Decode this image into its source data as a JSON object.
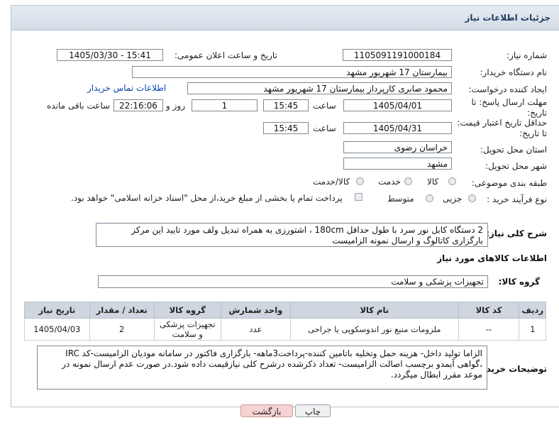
{
  "panel": {
    "title": "جزئیات اطلاعات نیاز"
  },
  "form": {
    "need_number": {
      "label": "شماره نیاز:",
      "value": "1105091191000184"
    },
    "announce": {
      "label": "تاریخ و ساعت اعلان عمومی:",
      "value": "1405/03/30 - 15:41"
    },
    "buyer_org": {
      "label": "نام دستگاه خریدار:",
      "value": "بیمارستان 17 شهریور مشهد"
    },
    "requester": {
      "label": "ایجاد کننده درخواست:",
      "value": "محمود صابری کارپرداز بیمارستان 17 شهریور مشهد",
      "contact_link": "اطلاعات تماس خریدار"
    },
    "deadline": {
      "label1": "مهلت ارسال پاسخ: تا",
      "label2": "تاریخ:",
      "date": "1405/04/01",
      "time_label": "ساعت",
      "time": "15:45",
      "days": "1",
      "days_label": "روز و",
      "remaining": "22:16:06",
      "remaining_label": "ساعت باقی مانده"
    },
    "validity": {
      "label1": "حداقل تاریخ اعتبار قیمت:",
      "label2": "تا تاریخ:",
      "date": "1405/04/31",
      "time_label": "ساعت",
      "time": "15:45"
    },
    "province": {
      "label": "استان محل تحویل:",
      "value": "خراسان رضوی"
    },
    "city": {
      "label": "شهر محل تحویل:",
      "value": "مشهد"
    },
    "category": {
      "label": "طبقه بندی موضوعی:",
      "options": [
        "کالا",
        "خدمت",
        "کالا/خدمت"
      ]
    },
    "process": {
      "label": "نوع فرآیند خرید :",
      "options": [
        "جزیی",
        "متوسط"
      ],
      "payment_note": "پرداخت تمام یا بخشی از مبلغ خرید،از محل \"اسناد خزانه اسلامی\" خواهد بود."
    }
  },
  "summary": {
    "label": "شرح کلی نیاز:",
    "text": "2 دستگاه کابل نور سرد با طول حداقل 180cm ، اشتورزی به همراه تبدیل ولف مورد تایید این مرکز بارگزاری کاتالوگ و ارسال نمونه الزامیست"
  },
  "goods_info": {
    "title": "اطلاعات کالاهای مورد نیاز"
  },
  "goods_group": {
    "label": "گروه کالا:",
    "value": "تجهیزات پزشکی و سلامت"
  },
  "table": {
    "headers": [
      "ردیف",
      "کد کالا",
      "نام کالا",
      "واحد شمارش",
      "گروه کالا",
      "تعداد / مقدار",
      "تاریخ نیاز"
    ],
    "rows": [
      [
        "1",
        "--",
        "ملزومات منبع نور اندوسکوپی یا جراحی",
        "عدد",
        "تجهیزات پزشکی و سلامت",
        "2",
        "1405/04/03"
      ]
    ]
  },
  "buyer_notes": {
    "label": "توضیحات خریدار:",
    "text": "الزاما تولید داخل- هزینه حمل وتخلیه باتامین کننده-پرداخت3ماهه- بارگزاری فاکتور در سامانه مودیان الزامیست-کد IRC ،گواهی آیمدو برچسب اصالت الزامیست- تعداد ذکرشده درشرح کلی نیازقیمت داده شود.در صورت عدم ارسال نمونه در موعد مقرر ابطال میگردد."
  },
  "buttons": {
    "print": "چاپ",
    "back": "بازگشت"
  },
  "colors": {
    "header_bg": "#d4dce7",
    "back_button": "#f6d2d2",
    "print_button": "#eef0f2",
    "link": "#0645ad"
  }
}
